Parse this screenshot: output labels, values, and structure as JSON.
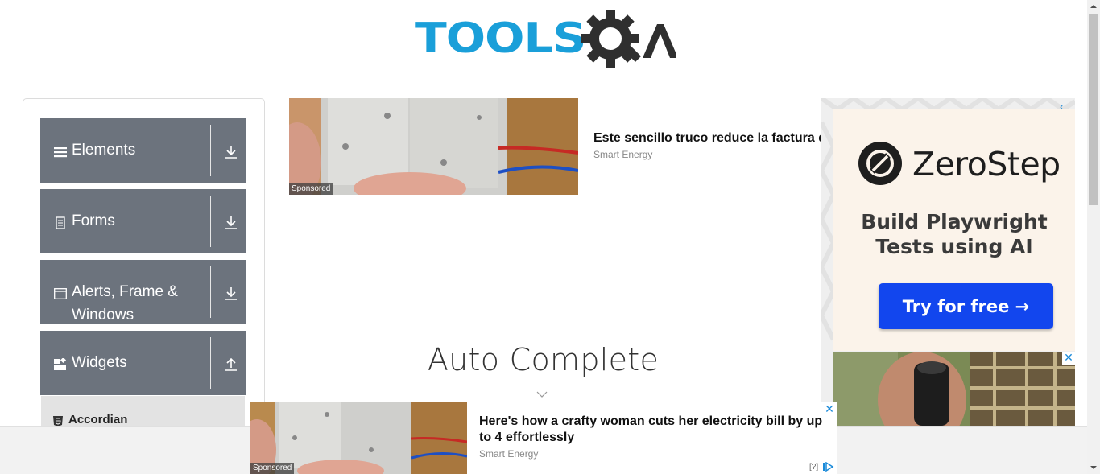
{
  "header": {
    "logo_text": "TOOLS",
    "logo_suffix": "A",
    "logo_icon": "gear-magnifier-icon"
  },
  "sidebar": {
    "groups": [
      {
        "label": "Elements",
        "icon": "hamburger-icon",
        "arrow": "download-arrow-icon"
      },
      {
        "label": "Forms",
        "icon": "document-icon",
        "arrow": "download-arrow-icon"
      },
      {
        "label": "Alerts, Frame & Windows",
        "icon": "window-icon",
        "arrow": "download-arrow-icon"
      },
      {
        "label": "Widgets",
        "icon": "widgets-icon",
        "arrow": "upload-arrow-icon"
      }
    ],
    "sub_items": [
      {
        "label": "Accordian",
        "icon": "html5-icon"
      }
    ]
  },
  "top_ad": {
    "title": "Este sencillo truco reduce la factura de la luz",
    "source": "Smart Energy",
    "sponsored": "Sponsored"
  },
  "main": {
    "title": "Auto Complete"
  },
  "side_ad": {
    "brand": "ZeroStep",
    "tagline_line1": "Build Playwright",
    "tagline_line2": "Tests using AI",
    "cta": "Try for free →",
    "adchoices": "‹",
    "close": "✕"
  },
  "bottom_ad": {
    "title": "Here's how a crafty woman cuts her electricity bill by up to 4 effortlessly",
    "source": "Smart Energy",
    "sponsored": "Sponsored",
    "close": "✕",
    "help": "[?]"
  },
  "colors": {
    "brand_blue": "#1a9fd9",
    "sidebar_group": "#6c737d",
    "cta_blue": "#1246ee",
    "ad_link": "#1a8ad9"
  }
}
